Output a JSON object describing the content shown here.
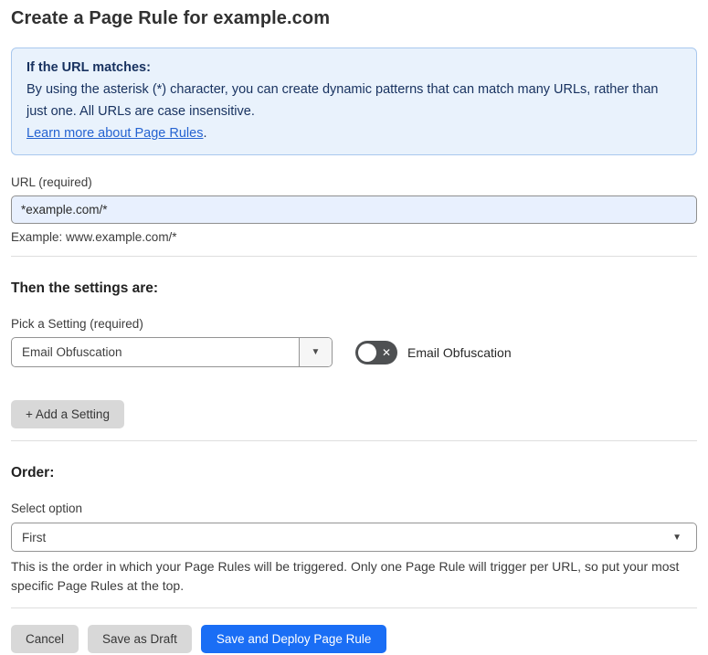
{
  "page": {
    "title": "Create a Page Rule for example.com"
  },
  "info_box": {
    "heading": "If the URL matches:",
    "body": "By using the asterisk (*) character, you can create dynamic patterns that can match many URLs, rather than just one. All URLs are case insensitive.",
    "link_text": "Learn more about Page Rules",
    "link_suffix": "."
  },
  "url_field": {
    "label": "URL (required)",
    "value": "*example.com/*",
    "example": "Example: www.example.com/*"
  },
  "settings_section": {
    "heading": "Then the settings are:",
    "setting_label": "Pick a Setting (required)",
    "setting_value": "Email Obfuscation",
    "toggle_label": "Email Obfuscation",
    "toggle_state": "off",
    "add_button_label": "+ Add a Setting"
  },
  "order_section": {
    "heading": "Order:",
    "select_label": "Select option",
    "select_value": "First",
    "help_text": "This is the order in which your Page Rules will be triggered. Only one Page Rule will trigger per URL, so put your most specific Page Rules at the top."
  },
  "footer": {
    "cancel_label": "Cancel",
    "save_draft_label": "Save as Draft",
    "save_deploy_label": "Save and Deploy Page Rule"
  },
  "icons": {
    "chevron_down": "▼",
    "toggle_x": "✕"
  },
  "colors": {
    "accent_blue": "#1a6ef5",
    "info_box_bg": "#e9f2fc",
    "info_box_border": "#a9c8ee",
    "info_box_text": "#17315f",
    "link_blue": "#2563d1",
    "input_bg": "#e8f0fe",
    "gray_button_bg": "#d8d8d8",
    "toggle_off_bg": "#4e5052"
  }
}
